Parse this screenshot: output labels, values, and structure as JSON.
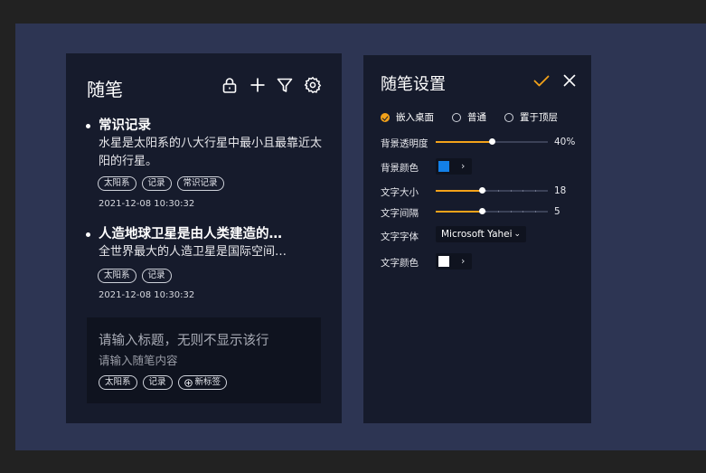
{
  "notes_panel": {
    "title": "随笔",
    "toolbar": [
      "lock-icon",
      "plus-icon",
      "filter-icon",
      "gear-icon"
    ],
    "notes": [
      {
        "title": "常识记录",
        "body": "水星是太阳系的八大行星中最小且最靠近太阳的行星。",
        "tags": [
          "太阳系",
          "记录",
          "常识记录"
        ],
        "date": "2021-12-08 10:30:32"
      },
      {
        "title": "人造地球卫星是由人类建造的…",
        "body": "全世界最大的人造卫星是国际空间…",
        "tags": [
          "太阳系",
          "记录"
        ],
        "date": "2021-12-08 10:30:32"
      }
    ],
    "composer": {
      "title_placeholder": "请输入标题，无则不显示该行",
      "body_placeholder": "请输入随笔内容",
      "tags": [
        "太阳系",
        "记录"
      ],
      "new_tag_label": "新标签"
    }
  },
  "settings_panel": {
    "title": "随笔设置",
    "mode_options": [
      {
        "label": "嵌入桌面",
        "selected": true
      },
      {
        "label": "普通",
        "selected": false
      },
      {
        "label": "置于顶层",
        "selected": false
      }
    ],
    "bg_opacity": {
      "label": "背景透明度",
      "value_text": "40%",
      "level": 0.5
    },
    "bg_color": {
      "label": "背景颜色",
      "color": "#1380e8"
    },
    "font_size": {
      "label": "文字大小",
      "value_text": "18",
      "level": 0.41
    },
    "letter_spacing": {
      "label": "文字间隔",
      "value_text": "5",
      "level": 0.41
    },
    "font_family": {
      "label": "文字字体",
      "value": "Microsoft Yahei"
    },
    "text_color": {
      "label": "文字颜色",
      "color": "#ffffff"
    }
  },
  "colors": {
    "accent": "#f3a21a",
    "panel_bg": "#161b2c",
    "desktop_bg": "#2d3553"
  }
}
